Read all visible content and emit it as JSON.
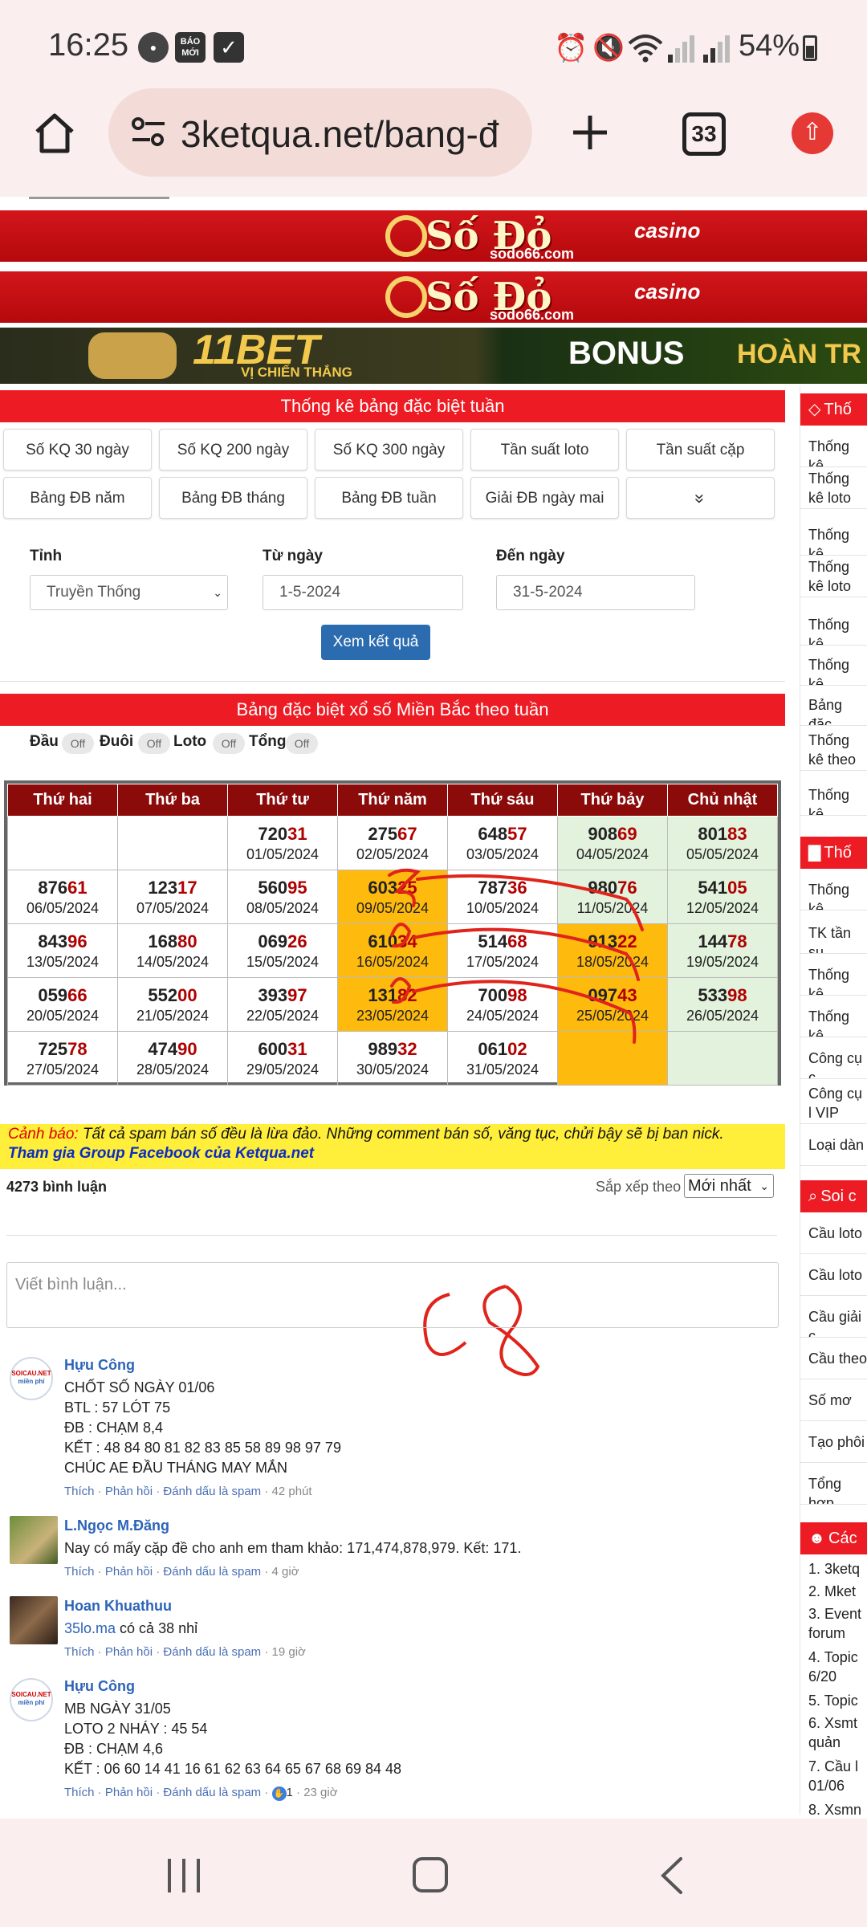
{
  "status": {
    "time": "16:25",
    "badge": "BÁO MỚI",
    "battery": "54%"
  },
  "browser": {
    "url": "3ketqua.net/bang-đ",
    "tab_count": "33"
  },
  "banners": {
    "sodo_title": "Số Đỏ",
    "sodo_casino": "casino",
    "sodo_site": "sodo66.com",
    "bet_title": "11BET",
    "bet_sub": "VỊ CHIẾN THẮNG",
    "bet_bonus": "BONUS",
    "bet_bonus2": "HOÀN TR"
  },
  "stats": {
    "header": "Thống kê bảng đặc biệt tuần",
    "nav": [
      "Số KQ 30 ngày",
      "Số KQ 200 ngày",
      "Số KQ 300 ngày",
      "Tần suất loto",
      "Tần suất cặp",
      "Bảng ĐB năm",
      "Bảng ĐB tháng",
      "Bảng ĐB tuần",
      "Giải ĐB ngày mai"
    ]
  },
  "form": {
    "province_label": "Tỉnh",
    "province_value": "Truyền Thống",
    "from_label": "Từ ngày",
    "from_value": "1-5-2024",
    "to_label": "Đến ngày",
    "to_value": "31-5-2024",
    "submit": "Xem kết quả"
  },
  "board": {
    "header": "Bảng đặc biệt xổ số Miền Bắc theo tuần",
    "toggles": [
      {
        "label": "Đầu",
        "state": "Off"
      },
      {
        "label": "Đuôi",
        "state": "Off"
      },
      {
        "label": "Loto",
        "state": "Off"
      },
      {
        "label": "Tổng",
        "state": "Off"
      }
    ],
    "days": [
      "Thứ hai",
      "Thứ ba",
      "Thứ tư",
      "Thứ năm",
      "Thứ sáu",
      "Thứ bảy",
      "Chủ nhật"
    ],
    "rows": [
      [
        {
          "head": "",
          "tail": "",
          "date": ""
        },
        {
          "head": "",
          "tail": "",
          "date": ""
        },
        {
          "head": "720",
          "tail": "31",
          "date": "01/05/2024"
        },
        {
          "head": "275",
          "tail": "67",
          "date": "02/05/2024"
        },
        {
          "head": "648",
          "tail": "57",
          "date": "03/05/2024"
        },
        {
          "head": "908",
          "tail": "69",
          "date": "04/05/2024"
        },
        {
          "head": "801",
          "tail": "83",
          "date": "05/05/2024"
        }
      ],
      [
        {
          "head": "876",
          "tail": "61",
          "date": "06/05/2024"
        },
        {
          "head": "123",
          "tail": "17",
          "date": "07/05/2024"
        },
        {
          "head": "560",
          "tail": "95",
          "date": "08/05/2024"
        },
        {
          "head": "603",
          "tail": "25",
          "date": "09/05/2024"
        },
        {
          "head": "787",
          "tail": "36",
          "date": "10/05/2024"
        },
        {
          "head": "980",
          "tail": "76",
          "date": "11/05/2024"
        },
        {
          "head": "541",
          "tail": "05",
          "date": "12/05/2024"
        }
      ],
      [
        {
          "head": "843",
          "tail": "96",
          "date": "13/05/2024"
        },
        {
          "head": "168",
          "tail": "80",
          "date": "14/05/2024"
        },
        {
          "head": "069",
          "tail": "26",
          "date": "15/05/2024"
        },
        {
          "head": "610",
          "tail": "34",
          "date": "16/05/2024"
        },
        {
          "head": "514",
          "tail": "68",
          "date": "17/05/2024"
        },
        {
          "head": "913",
          "tail": "22",
          "date": "18/05/2024"
        },
        {
          "head": "144",
          "tail": "78",
          "date": "19/05/2024"
        }
      ],
      [
        {
          "head": "059",
          "tail": "66",
          "date": "20/05/2024"
        },
        {
          "head": "552",
          "tail": "00",
          "date": "21/05/2024"
        },
        {
          "head": "393",
          "tail": "97",
          "date": "22/05/2024"
        },
        {
          "head": "131",
          "tail": "82",
          "date": "23/05/2024"
        },
        {
          "head": "700",
          "tail": "98",
          "date": "24/05/2024"
        },
        {
          "head": "097",
          "tail": "43",
          "date": "25/05/2024"
        },
        {
          "head": "533",
          "tail": "98",
          "date": "26/05/2024"
        }
      ],
      [
        {
          "head": "725",
          "tail": "78",
          "date": "27/05/2024"
        },
        {
          "head": "474",
          "tail": "90",
          "date": "28/05/2024"
        },
        {
          "head": "600",
          "tail": "31",
          "date": "29/05/2024"
        },
        {
          "head": "989",
          "tail": "32",
          "date": "30/05/2024"
        },
        {
          "head": "061",
          "tail": "02",
          "date": "31/05/2024"
        },
        {
          "head": "",
          "tail": "",
          "date": ""
        },
        {
          "head": "",
          "tail": "",
          "date": ""
        }
      ]
    ],
    "handwriting": "C8"
  },
  "warning": {
    "label": "Cảnh báo:",
    "text": " Tất cả spam bán số đều là lừa đảo. Những comment bán số, văng tục, chửi bậy sẽ bị ban nick.",
    "group_link": "Tham gia Group Facebook của Ketqua.net"
  },
  "comments": {
    "count": "4273 bình luận",
    "sort_label": "Sắp xếp theo",
    "sort_value": "Mới nhất",
    "placeholder": "Viết bình luận...",
    "like": "Thích",
    "reply": "Phản hồi",
    "spam": "Đánh dấu là spam",
    "avatar_text1": "SOICAU.NET",
    "avatar_text2": "miền phí",
    "items": [
      {
        "name": "Hựu Công",
        "lines": [
          "CHỐT SỐ NGÀY 01/06",
          "BTL : 57 LÓT 75",
          "ĐB : CHẠM 8,4",
          "KẾT : 48 84 80 81 82 83 85 58 89 98 97 79",
          "CHÚC AE ĐẦU THÁNG MAY MẮN"
        ],
        "time": "42 phút"
      },
      {
        "name": "L.Ngọc M.Đăng",
        "lines": [
          "Nay có mấy cặp đề cho anh em tham khảo: 171,474,878,979. Kết: 171."
        ],
        "time": "4 giờ"
      },
      {
        "name": "Hoan Khuathuu",
        "link": "35lo.ma",
        "lines": [
          " có cả 38 nhỉ"
        ],
        "time": "19 giờ"
      },
      {
        "name": "Hựu Công",
        "lines": [
          "MB NGÀY 31/05",
          "LOTO 2 NHÁY : 45 54",
          "ĐB : CHẠM 4,6",
          "KẾT : 06 60 14 41 16 61 62 63 64 65 67 68 69 84 48"
        ],
        "likes": "1",
        "time": "23 giờ"
      }
    ]
  },
  "sidebar": {
    "head1": "Thố",
    "items1": [
      "Thống kê",
      "Thống kê loto",
      "Thống kê",
      "Thống kê loto",
      "Thống kê",
      "Thống kê",
      "Bảng đặc",
      "Thống kê theo Đặc",
      "Thống kê"
    ],
    "head2": "Thố",
    "items2": [
      "Thống kê",
      "TK tần su",
      "Thống kê",
      "Thống kê",
      "Công cụ c",
      "Công cụ l VIP",
      "Loại dàn"
    ],
    "head3": "Soi c",
    "items3": [
      "Cầu loto",
      "Cầu loto",
      "Cầu giải c",
      "Cầu theo",
      "Số mơ",
      "Tạo phôi",
      "Tổng hợp"
    ],
    "head4": "Các",
    "list4": [
      "1. 3ketq",
      "2. Mket",
      "3. Event forum",
      "4. Topic 6/20",
      "5. Topic",
      "6. Xsmt quản",
      "7. Cầu l 01/06",
      "8. Xsmn"
    ]
  }
}
